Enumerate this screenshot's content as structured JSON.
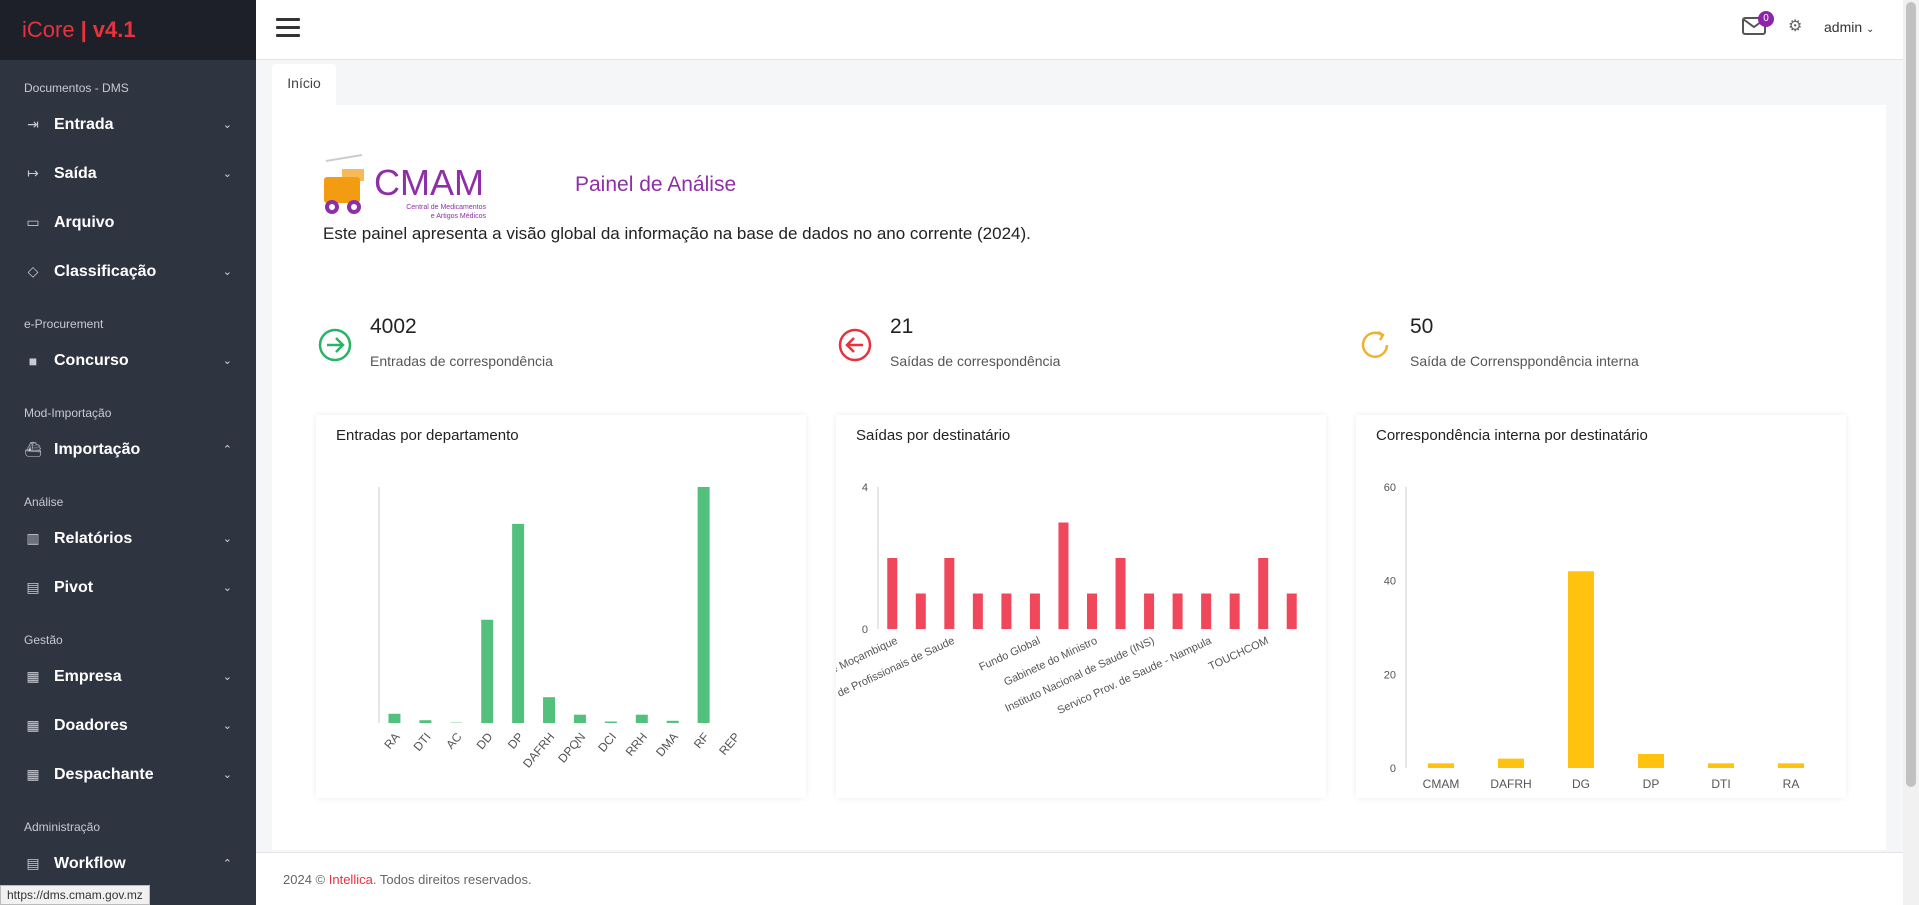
{
  "brand": {
    "name": "iCore",
    "version": "v4.1"
  },
  "sidebar": {
    "sections": [
      {
        "title": "Documentos - DMS",
        "items": [
          {
            "label": "Entrada",
            "icon": "sign-in-icon",
            "chevron": "down"
          },
          {
            "label": "Saída",
            "icon": "sign-out-icon",
            "chevron": "down"
          },
          {
            "label": "Arquivo",
            "icon": "archive-icon",
            "chevron": ""
          },
          {
            "label": "Classificação",
            "icon": "tag-icon",
            "chevron": "down"
          }
        ]
      },
      {
        "title": "e-Procurement",
        "items": [
          {
            "label": "Concurso",
            "icon": "folder-icon",
            "chevron": "down"
          }
        ]
      },
      {
        "title": "Mod-Importação",
        "items": [
          {
            "label": "Importação",
            "icon": "ship-icon",
            "chevron": "up"
          }
        ]
      },
      {
        "title": "Análise",
        "items": [
          {
            "label": "Relatórios",
            "icon": "bar-chart-icon",
            "chevron": "down"
          },
          {
            "label": "Pivot",
            "icon": "file-icon",
            "chevron": "down"
          }
        ]
      },
      {
        "title": "Gestão",
        "items": [
          {
            "label": "Empresa",
            "icon": "building-icon",
            "chevron": "down"
          },
          {
            "label": "Doadores",
            "icon": "building-icon",
            "chevron": "down"
          },
          {
            "label": "Despachante",
            "icon": "building-icon",
            "chevron": "down"
          }
        ]
      },
      {
        "title": "Administração",
        "items": [
          {
            "label": "Workflow",
            "icon": "table-icon",
            "chevron": "up"
          }
        ]
      }
    ]
  },
  "topbar": {
    "mail_count": "0",
    "user": "admin"
  },
  "breadcrumb": {
    "tab": "Início"
  },
  "logo": {
    "text": "CMAM",
    "sub1": "Central de Medicamentos",
    "sub2": "e Artigos Médicos"
  },
  "panel": {
    "title": "Painel de Análise",
    "description": "Este painel apresenta a visão global da informação na base de dados no ano corrente (2024)."
  },
  "stats": [
    {
      "value": "4002",
      "caption": "Entradas de correspondência",
      "color": "#28b463",
      "icon": "arrow-right-circle-icon"
    },
    {
      "value": "21",
      "caption": "Saídas de correspondência",
      "color": "#e8323c",
      "icon": "arrow-left-circle-icon"
    },
    {
      "value": "50",
      "caption": "Saída de Corrensppondência interna",
      "color": "#f0b132",
      "icon": "refresh-icon"
    }
  ],
  "chart_data": [
    {
      "type": "bar",
      "title": "Entradas por departamento",
      "categories": [
        "RA",
        "DTI",
        "AC",
        "DD",
        "DP",
        "DAFRH",
        "DPQN",
        "DCI",
        "RRH",
        "DMA",
        "RF",
        "REP"
      ],
      "values": [
        50,
        15,
        2,
        560,
        1080,
        140,
        45,
        8,
        45,
        12,
        1280,
        0
      ],
      "ylim": [
        0,
        1280
      ],
      "color": "#53c07d"
    },
    {
      "type": "bar",
      "title": "Saídas por destinatário",
      "categories": [
        "Banco de Moçambique",
        "",
        "Associacao de Profissionais de Saude",
        "",
        "",
        "Fundo Global",
        "",
        "Gabinete do Ministro",
        "",
        "Instituto Nacional de Saude (INS)",
        "",
        "Servico Prov. de Saude - Nampula",
        "",
        "TOUCHCOM",
        ""
      ],
      "values": [
        2,
        1,
        2,
        1,
        1,
        1,
        3,
        1,
        2,
        1,
        1,
        1,
        1,
        2,
        1
      ],
      "ylim": [
        0,
        4
      ],
      "yticks": [
        0,
        4
      ],
      "color": "#f0475b"
    },
    {
      "type": "bar",
      "title": "Correspondência interna por destinatário",
      "categories": [
        "CMAM",
        "DAFRH",
        "DG",
        "DP",
        "DTI",
        "RA"
      ],
      "values": [
        1,
        2,
        42,
        3,
        1,
        1
      ],
      "ylim": [
        0,
        60
      ],
      "yticks": [
        0,
        20,
        40,
        60
      ],
      "color": "#ffc20e"
    }
  ],
  "footer": {
    "year": "2024 ©",
    "company": "Intellica.",
    "rights": "Todos direitos reservados."
  },
  "status_url": "https://dms.cmam.gov.mz"
}
